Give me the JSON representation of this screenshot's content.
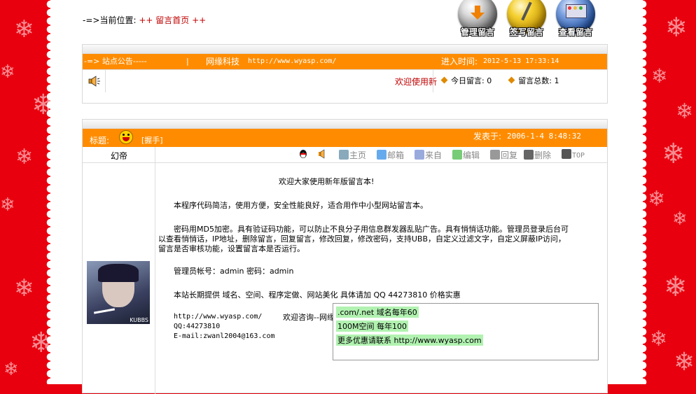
{
  "location": {
    "prefix": "-=>当前位置:",
    "sep1": "++",
    "page": "留言首页",
    "sep2": "++"
  },
  "top_buttons": [
    {
      "label": "管理留言",
      "color": "#f08000"
    },
    {
      "label": "签写留言",
      "color": "#e0b000"
    },
    {
      "label": "查看留言",
      "color": "#3060c0"
    }
  ],
  "notice": {
    "label": "-=> 站点公告-----",
    "divider": "|",
    "site_name": "网缘科技",
    "site_url": "http://www.wyasp.com/",
    "time_label": "进入时间:",
    "time_value": "2012-5-13 17:33:14",
    "marquee": "欢迎使用新",
    "today_label": "今日留言:",
    "today_value": "0",
    "total_label": "留言总数:",
    "total_value": "1"
  },
  "message": {
    "title_label": "标题:",
    "title_text": "[握手]",
    "posted_label": "发表于:",
    "posted_value": "2006-1-4 8:48:32",
    "author": "幻帝",
    "avatar_label": "KUBBS",
    "tools": [
      "主页",
      "邮箱",
      "来自",
      "编辑",
      "回复",
      "删除",
      "TOP"
    ],
    "heading": "欢迎大家使用新年版留言本!",
    "para1": "本程序代码简洁，使用方便，安全性能良好，适合用作中小型网站留言本。",
    "para2_l1": "密码用MD5加密。具有验证码功能，可以防止不良分子用信息群发器乱贴广告。具有悄悄话功能。管理员登录后台可",
    "para2_l2": "以查看悄悄话，IP地址，删除留言，回复留言，修改回复，修改密码，支持UBB，自定义过滤文字，自定义屏蔽IP访问，",
    "para2_l3": "留言是否审核功能，设置留言本是否运行。",
    "admin_line": "管理员帐号：admin 密码：admin",
    "service_line": "本站长期提供 域名、空间、程序定做、网站美化 具体请加 QQ 44273810  价格实惠",
    "url_line": "http://www.wyasp.com/",
    "consult": "欢迎咨询--网缘科技",
    "qq_line": "QQ:44273810",
    "email_line": "E-mail:zwanl2004@163.com",
    "ad1": ".com/.net 域名每年60",
    "ad2": "100M空间  每年100",
    "ad3": "更多优惠请联系 http://www.wyasp.com"
  },
  "colors": {
    "accent": "#ff8c00",
    "link_red": "#c00000",
    "background": "#e8000e"
  }
}
